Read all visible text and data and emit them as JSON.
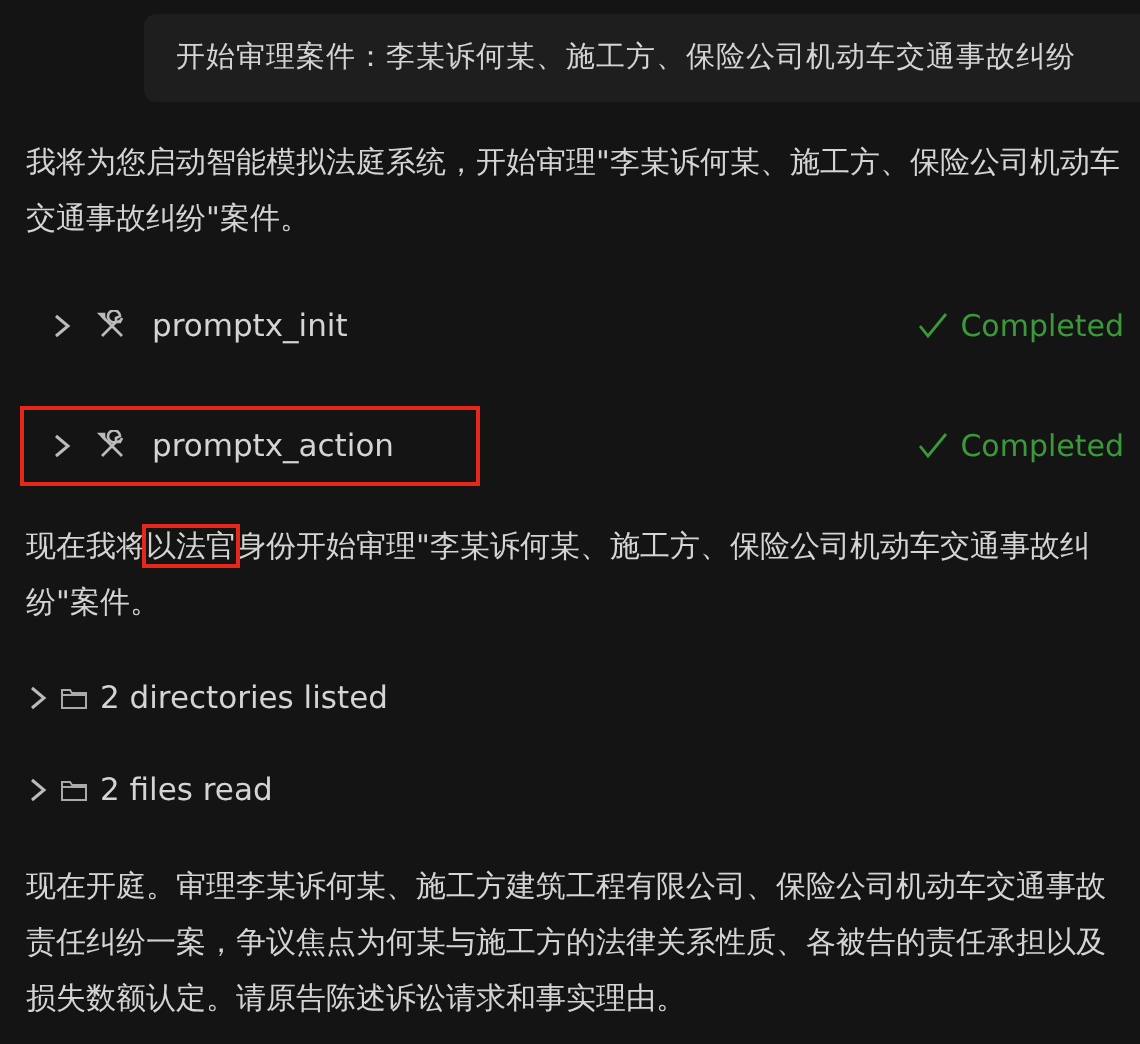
{
  "user_message": {
    "text": "开始审理案件：李某诉何某、施工方、保险公司机动车交通事故纠纷"
  },
  "messages": [
    {
      "kind": "text",
      "segments": [
        {
          "text": "我将为您启动智能模拟法庭系统，开始审理\"李某诉何某、施工方、保险公司机动车交通事故纠纷\"案件。",
          "highlighted": false
        }
      ]
    },
    {
      "kind": "tool",
      "name": "promptx_init",
      "status": "Completed",
      "expanded": false,
      "highlighted": false
    },
    {
      "kind": "tool",
      "name": "promptx_action",
      "status": "Completed",
      "expanded": false,
      "highlighted": true
    },
    {
      "kind": "text",
      "segments": [
        {
          "text": "现在我将",
          "highlighted": false
        },
        {
          "text": "以法官",
          "highlighted": true
        },
        {
          "text": "身份开始审理\"李某诉何某、施工方、保险公司机动车交通事故纠纷\"案件。",
          "highlighted": false
        }
      ]
    },
    {
      "kind": "files",
      "label": "2 directories listed",
      "expanded": false
    },
    {
      "kind": "files",
      "label": "2 files read",
      "expanded": false
    },
    {
      "kind": "text",
      "segments": [
        {
          "text": "现在开庭。审理李某诉何某、施工方建筑工程有限公司、保险公司机动车交通事故责任纠纷一案，争议焦点为何某与施工方的法律关系性质、各被告的责任承担以及损失数额认定。请原告陈述诉讼请求和事实理由。",
          "highlighted": false
        }
      ]
    }
  ]
}
